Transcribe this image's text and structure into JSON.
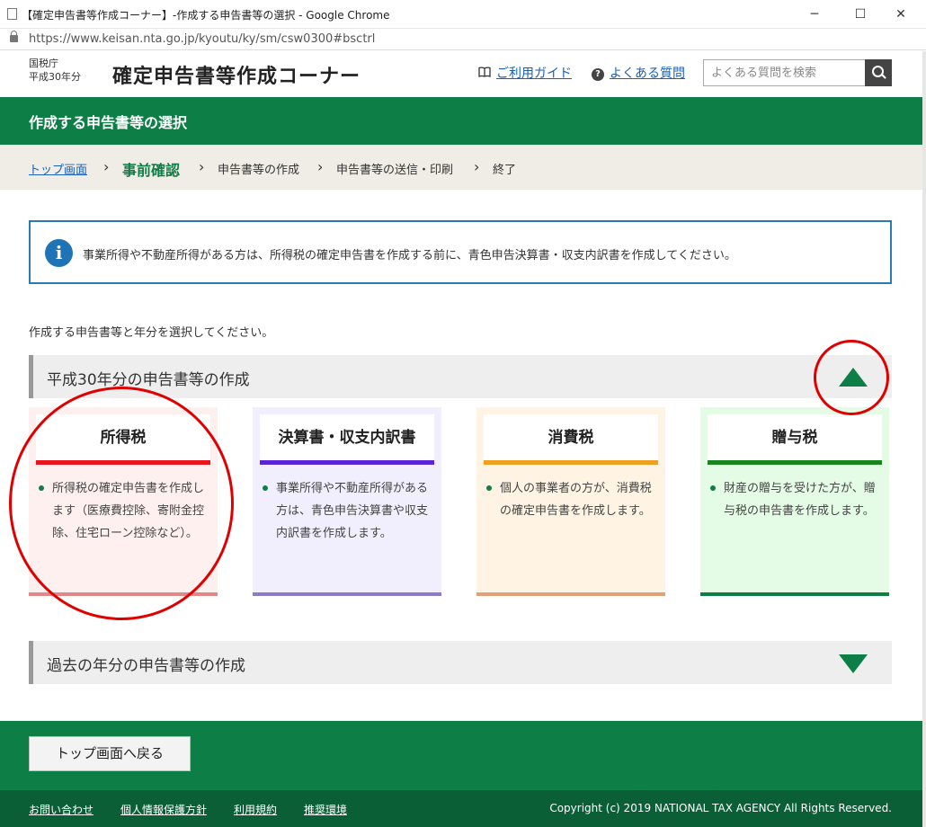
{
  "window": {
    "title": "【確定申告書等作成コーナー】-作成する申告書等の選択 - Google Chrome",
    "minimize": "─",
    "maximize": "☐",
    "close": "✕"
  },
  "browser": {
    "url": "https://www.keisan.nta.go.jp/kyoutu/ky/sm/csw0300#bsctrl"
  },
  "header": {
    "agency": "国税庁",
    "year": "平成30年分",
    "site_title": "確定申告書等作成コーナー",
    "guide_link": "ご利用ガイド",
    "faq_link": "よくある質問",
    "search_placeholder": "よくある質問を検索"
  },
  "page_heading": "作成する申告書等の選択",
  "breadcrumb": {
    "top": "トップ画面",
    "current": "事前確認",
    "step2": "申告書等の作成",
    "step3": "申告書等の送信・印刷",
    "step4": "終了",
    "separator": "›"
  },
  "info_message": "事業所得や不動産所得がある方は、所得税の確定申告書を作成する前に、青色申告決算書・収支内訳書を作成してください。",
  "lead_text": "作成する申告書等と年分を選択してください。",
  "section_current": {
    "label": "平成30年分の申告書等の作成",
    "state": "expanded"
  },
  "cards": [
    {
      "title": "所得税",
      "desc": "所得税の確定申告書を作成します（医療費控除、寄附金控除、住宅ローン控除など）。",
      "bg": "#fff0f0",
      "accent": "#e8141e",
      "bottom": "#e08888"
    },
    {
      "title": "決算書・収支内訳書",
      "desc": "事業所得や不動産所得がある方は、青色申告決算書や収支内訳書を作成します。",
      "bg": "#f1effd",
      "accent": "#5b22d6",
      "bottom": "#8c7cc8"
    },
    {
      "title": "消費税",
      "desc": "個人の事業者の方が、消費税の確定申告書を作成します。",
      "bg": "#fff4e4",
      "accent": "#f0a020",
      "bottom": "#e0a078"
    },
    {
      "title": "贈与税",
      "desc": "財産の贈与を受けた方が、贈与税の申告書を作成します。",
      "bg": "#e4fbe6",
      "accent": "#16851c",
      "bottom": "#0d7e46"
    }
  ],
  "section_past": {
    "label": "過去の年分の申告書等の作成",
    "state": "collapsed"
  },
  "back_button": "トップ画面へ戻る",
  "footer": {
    "links": [
      "お問い合わせ",
      "個人情報保護方針",
      "利用規約",
      "推奨環境"
    ],
    "copyright": "Copyright (c) 2019 NATIONAL TAX AGENCY All Rights Reserved."
  },
  "colors": {
    "brand_green": "#0d7e46",
    "link_blue": "#1a5fb4",
    "annotation_red": "#e00000"
  }
}
